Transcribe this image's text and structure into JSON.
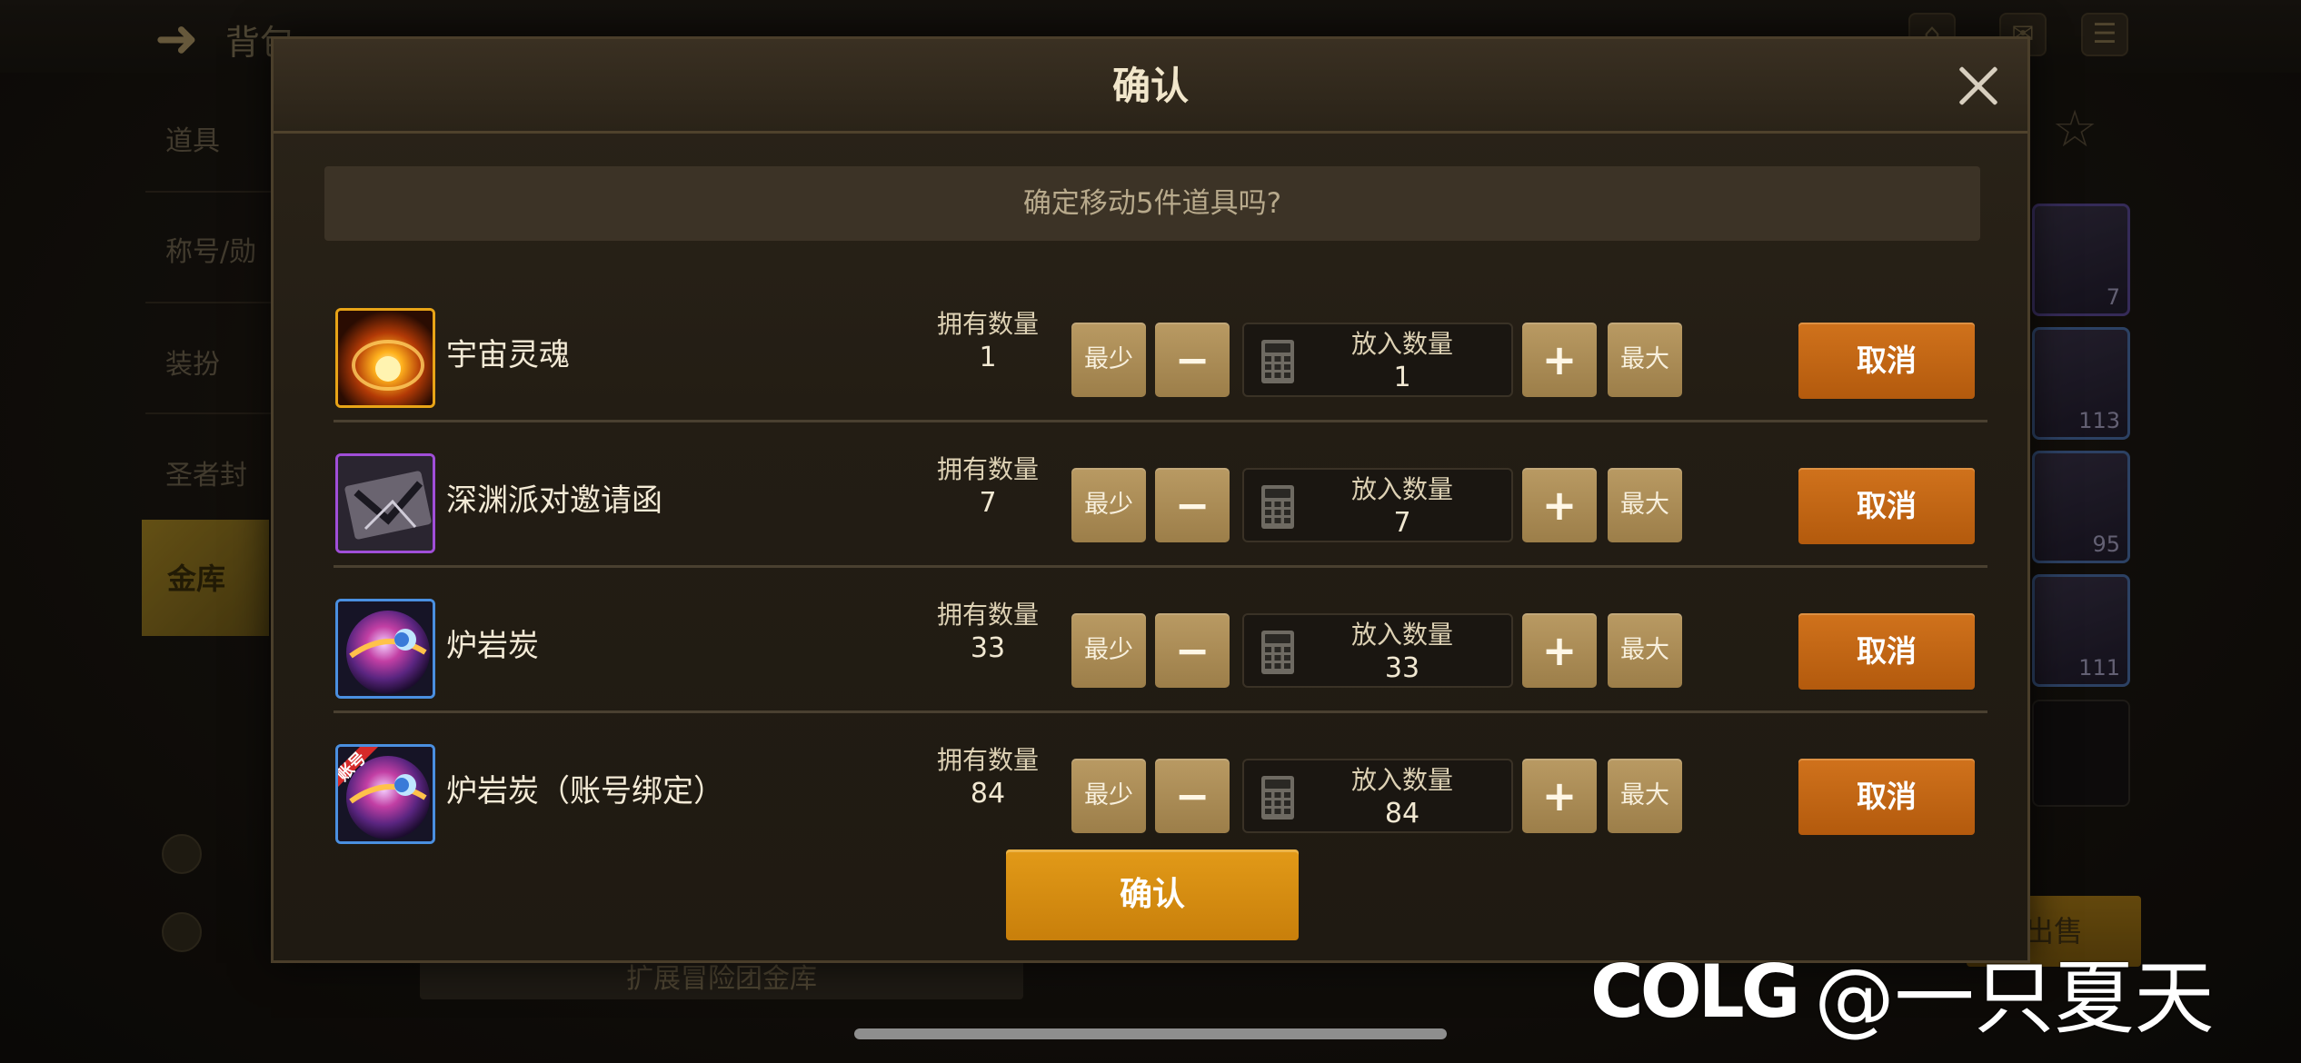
{
  "dialog": {
    "title": "确认",
    "prompt": "确定移动5件道具吗?",
    "confirm_label": "确认"
  },
  "labels": {
    "owned": "拥有数量",
    "put_in": "放入数量",
    "min": "最少",
    "max": "最大",
    "cancel": "取消",
    "minus": "−",
    "plus": "+"
  },
  "items": [
    {
      "name": "宇宙灵魂",
      "owned": "1",
      "put_in": "1",
      "icon": "cosmic-soul-icon",
      "rarity_color": "#e8a417"
    },
    {
      "name": "深渊派对邀请函",
      "owned": "7",
      "put_in": "7",
      "icon": "abyss-party-invitation-icon",
      "rarity_color": "#a04ed8"
    },
    {
      "name": "炉岩炭",
      "owned": "33",
      "put_in": "33",
      "icon": "furnace-rock-charcoal-icon",
      "rarity_color": "#4a8fe0"
    },
    {
      "name": "炉岩炭（账号绑定）",
      "owned": "84",
      "put_in": "84",
      "icon": "furnace-rock-charcoal-bound-icon",
      "rarity_color": "#4a8fe0",
      "badge": "账号"
    }
  ],
  "background": {
    "title": "背包",
    "sidebar": [
      "道具",
      "称号/勋",
      "装扮",
      "圣者封",
      "金库"
    ],
    "slot_counts": [
      "7",
      "113",
      "95",
      "111"
    ],
    "bottom_bar": "扩展冒险团金库",
    "sort_button": "出售"
  },
  "watermark": {
    "logo": "COLG",
    "text": "@一只夏天"
  },
  "colors": {
    "cancel": "#c86510",
    "confirm": "#d88c12",
    "tan_button": "#ad8d55"
  }
}
